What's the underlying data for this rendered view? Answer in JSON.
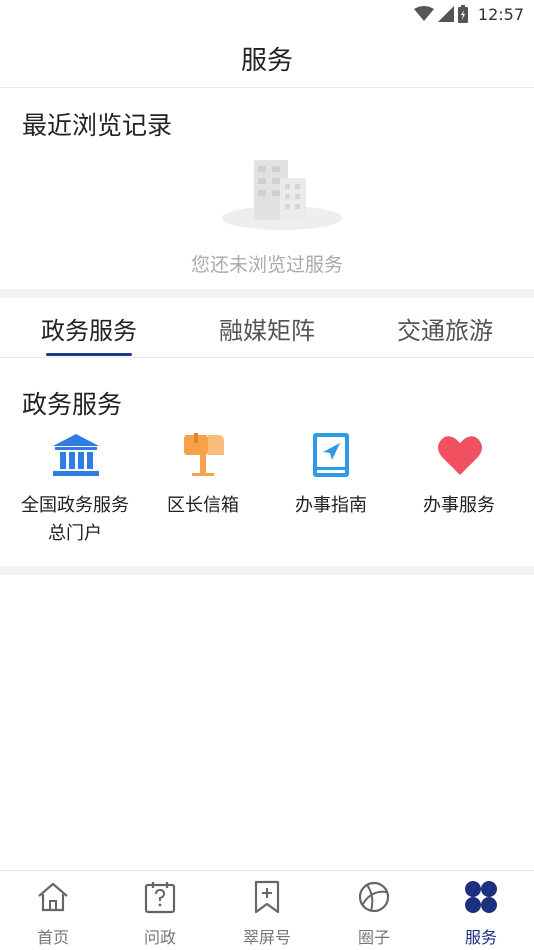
{
  "status_bar": {
    "time": "12:57"
  },
  "header": {
    "title": "服务"
  },
  "recent": {
    "title": "最近浏览记录",
    "empty_text": "您还未浏览过服务"
  },
  "tabs": [
    {
      "label": "政务服务",
      "active": true
    },
    {
      "label": "融媒矩阵",
      "active": false
    },
    {
      "label": "交通旅游",
      "active": false
    }
  ],
  "gov_services": {
    "title": "政务服务",
    "items": [
      {
        "label": "全国政务服务总门户",
        "icon": "bank-icon",
        "color": "#2f7de1"
      },
      {
        "label": "区长信箱",
        "icon": "mailbox-icon",
        "color": "#f5a24b"
      },
      {
        "label": "办事指南",
        "icon": "guide-book-icon",
        "color": "#2f9be8"
      },
      {
        "label": "办事服务",
        "icon": "heart-icon",
        "color": "#f0505f"
      }
    ]
  },
  "bottom_nav": [
    {
      "label": "首页",
      "icon": "home-icon",
      "active": false
    },
    {
      "label": "问政",
      "icon": "question-calendar-icon",
      "active": false
    },
    {
      "label": "翠屏号",
      "icon": "bookmark-plus-icon",
      "active": false
    },
    {
      "label": "圈子",
      "icon": "circle-orbit-icon",
      "active": false
    },
    {
      "label": "服务",
      "icon": "four-petal-icon",
      "active": true
    }
  ],
  "colors": {
    "accent": "#1e3a8a",
    "active_nav": "#1e2f80"
  }
}
